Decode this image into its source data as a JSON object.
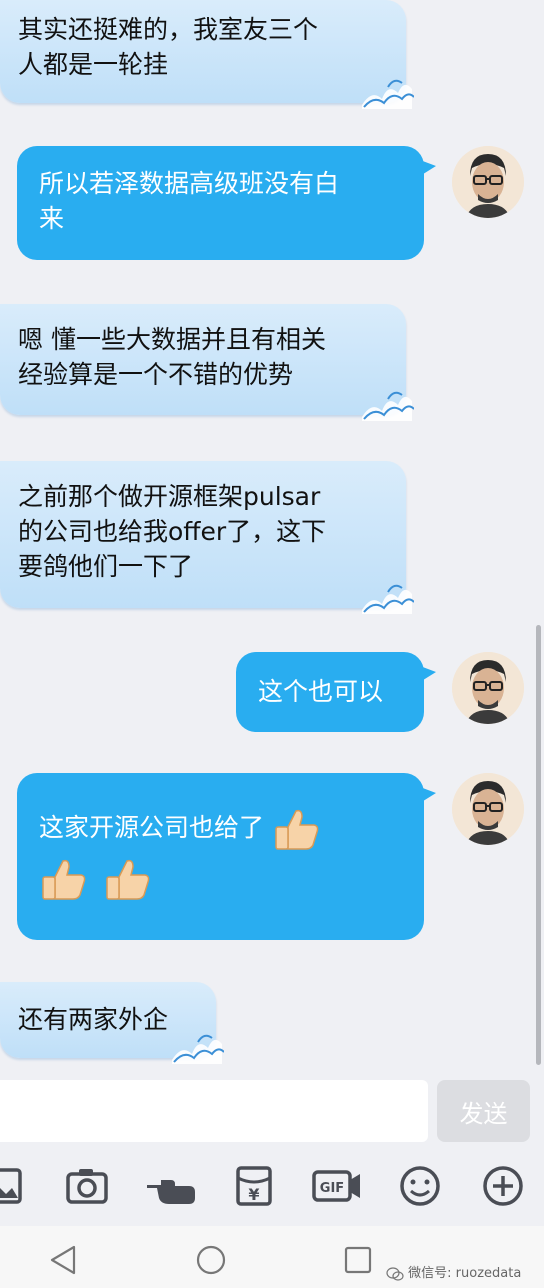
{
  "messages": [
    {
      "side": "in",
      "text_lines": [
        "其实还挺难的，我室友三个",
        "人都是一轮挂"
      ]
    },
    {
      "side": "out",
      "text_lines": [
        "所以若泽数据高级班没有白",
        "来"
      ]
    },
    {
      "side": "in",
      "text_lines": [
        "嗯 懂一些大数据并且有相关",
        "经验算是一个不错的优势"
      ]
    },
    {
      "side": "in",
      "text_lines": [
        "之前那个做开源框架pulsar",
        "的公司也给我offer了，这下",
        "要鸽他们一下了"
      ]
    },
    {
      "side": "out",
      "text_lines": [
        "这个也可以"
      ]
    },
    {
      "side": "out",
      "text_lines": [
        "这家开源公司也给了"
      ],
      "emoji": "thumbs-up x3"
    },
    {
      "side": "in",
      "text_lines": [
        "还有两家外企"
      ]
    }
  ],
  "composer": {
    "input_value": "",
    "send_label": "发送"
  },
  "toolbar": {
    "icons": [
      "image-icon",
      "camera-icon",
      "poke-icon",
      "red-packet-icon",
      "gif-icon",
      "emoji-icon",
      "plus-icon"
    ]
  },
  "navbar": {
    "icons": [
      "back-icon",
      "home-icon",
      "recents-icon"
    ]
  },
  "watermark": {
    "text": "微信号: ruozedata"
  },
  "colors": {
    "out_bubble": "#29adf0",
    "in_bubble": "#cfe7fa",
    "background": "#eff0f4"
  }
}
